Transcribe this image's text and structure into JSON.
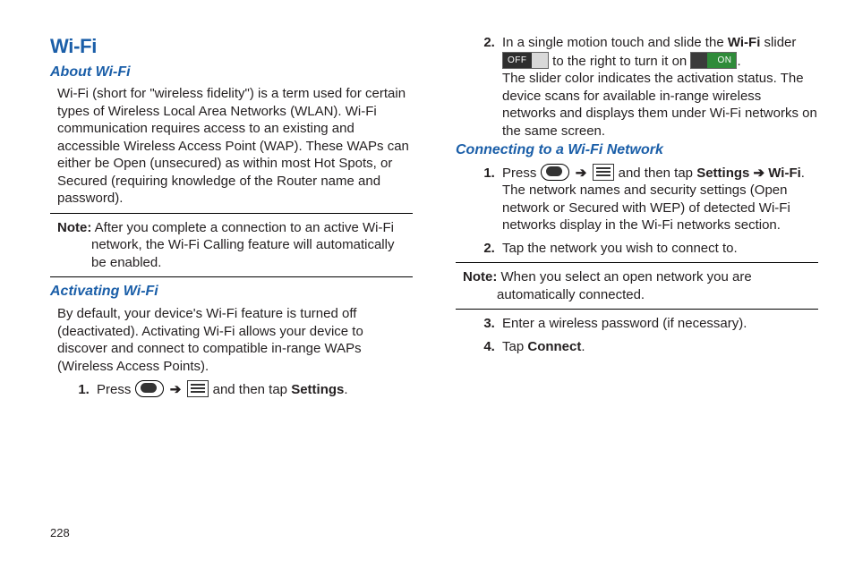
{
  "page": {
    "number": "228"
  },
  "title": "Wi-Fi",
  "about": {
    "heading": "About Wi-Fi",
    "body": "Wi-Fi (short for \"wireless fidelity\") is a term used for certain types of Wireless Local Area Networks (WLAN). Wi-Fi communication requires access to an existing and accessible Wireless Access Point (WAP). These WAPs can either be Open (unsecured) as within most Hot Spots, or Secured (requiring knowledge of the Router name and password).",
    "note_label": "Note:",
    "note": "After you complete a connection to an active Wi-Fi network, the Wi-Fi Calling feature will automatically be enabled."
  },
  "activating": {
    "heading": "Activating Wi-Fi",
    "body": "By default, your device's Wi-Fi feature is turned off (deactivated). Activating Wi-Fi allows your device to discover and connect to compatible in-range WAPs (Wireless Access Points).",
    "step1_a": "Press ",
    "step1_b": " and then tap ",
    "step1_c": "Settings",
    "step1_d": ".",
    "step2_a": "In a single motion touch and slide the ",
    "step2_b": "Wi-Fi",
    "step2_c": " slider ",
    "step2_d": " to the right to turn it on ",
    "step2_e": ".",
    "step2_f": "The slider color indicates the activation status. The device scans for available in-range wireless networks and displays them under Wi-Fi networks on the same screen."
  },
  "slider": {
    "off_label": "OFF",
    "on_label": "ON"
  },
  "connecting": {
    "heading": "Connecting to a Wi-Fi Network",
    "step1_a": "Press ",
    "step1_b": " and then tap ",
    "step1_c": "Settings ➔ Wi-Fi",
    "step1_d": ".",
    "step1_e": "The network names and security settings (Open network or Secured with WEP) of detected Wi-Fi networks display in the Wi-Fi networks section.",
    "step2": "Tap the network you wish to connect to.",
    "note_label": "Note:",
    "note": "When you select an open network you are automatically connected.",
    "step3": "Enter a wireless password (if necessary).",
    "step4_a": "Tap ",
    "step4_b": "Connect",
    "step4_c": "."
  },
  "nav": {
    "arrow": "➔"
  }
}
